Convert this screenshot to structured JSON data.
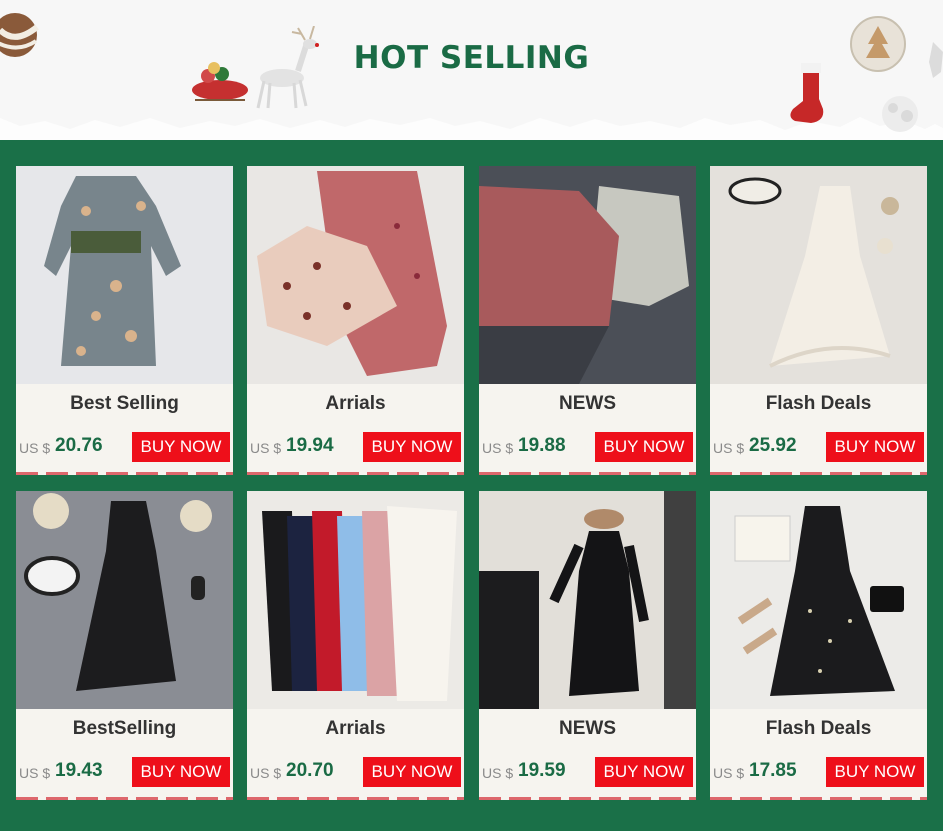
{
  "header": {
    "title": "HOT SELLING"
  },
  "colors": {
    "background": "#1a7048",
    "title": "#1a6b45",
    "price": "#1a6b45",
    "buy_button": "#ee0f1a",
    "card": "#f6f4ef"
  },
  "products": [
    {
      "title": "Best Selling",
      "currency": "US $",
      "price": "20.76",
      "button": "BUY NOW",
      "image": "grey-floral-wrap-dress"
    },
    {
      "title": "Arrials",
      "currency": "US $",
      "price": "19.94",
      "button": "BUY NOW",
      "image": "floral-top-and-skirt"
    },
    {
      "title": "NEWS",
      "currency": "US $",
      "price": "19.88",
      "button": "BUY NOW",
      "image": "pink-shirt-and-camisole"
    },
    {
      "title": "Flash Deals",
      "currency": "US $",
      "price": "25.92",
      "button": "BUY NOW",
      "image": "white-tulle-dress"
    },
    {
      "title": "BestSelling",
      "currency": "US $",
      "price": "19.43",
      "button": "BUY NOW",
      "image": "black-slip-dress"
    },
    {
      "title": "Arrials",
      "currency": "US $",
      "price": "20.70",
      "button": "BUY NOW",
      "image": "colored-lace-dresses"
    },
    {
      "title": "NEWS",
      "currency": "US $",
      "price": "19.59",
      "button": "BUY NOW",
      "image": "black-long-sleeve-dress"
    },
    {
      "title": "Flash Deals",
      "currency": "US $",
      "price": "17.85",
      "button": "BUY NOW",
      "image": "black-sparkle-tulle-dress"
    }
  ]
}
